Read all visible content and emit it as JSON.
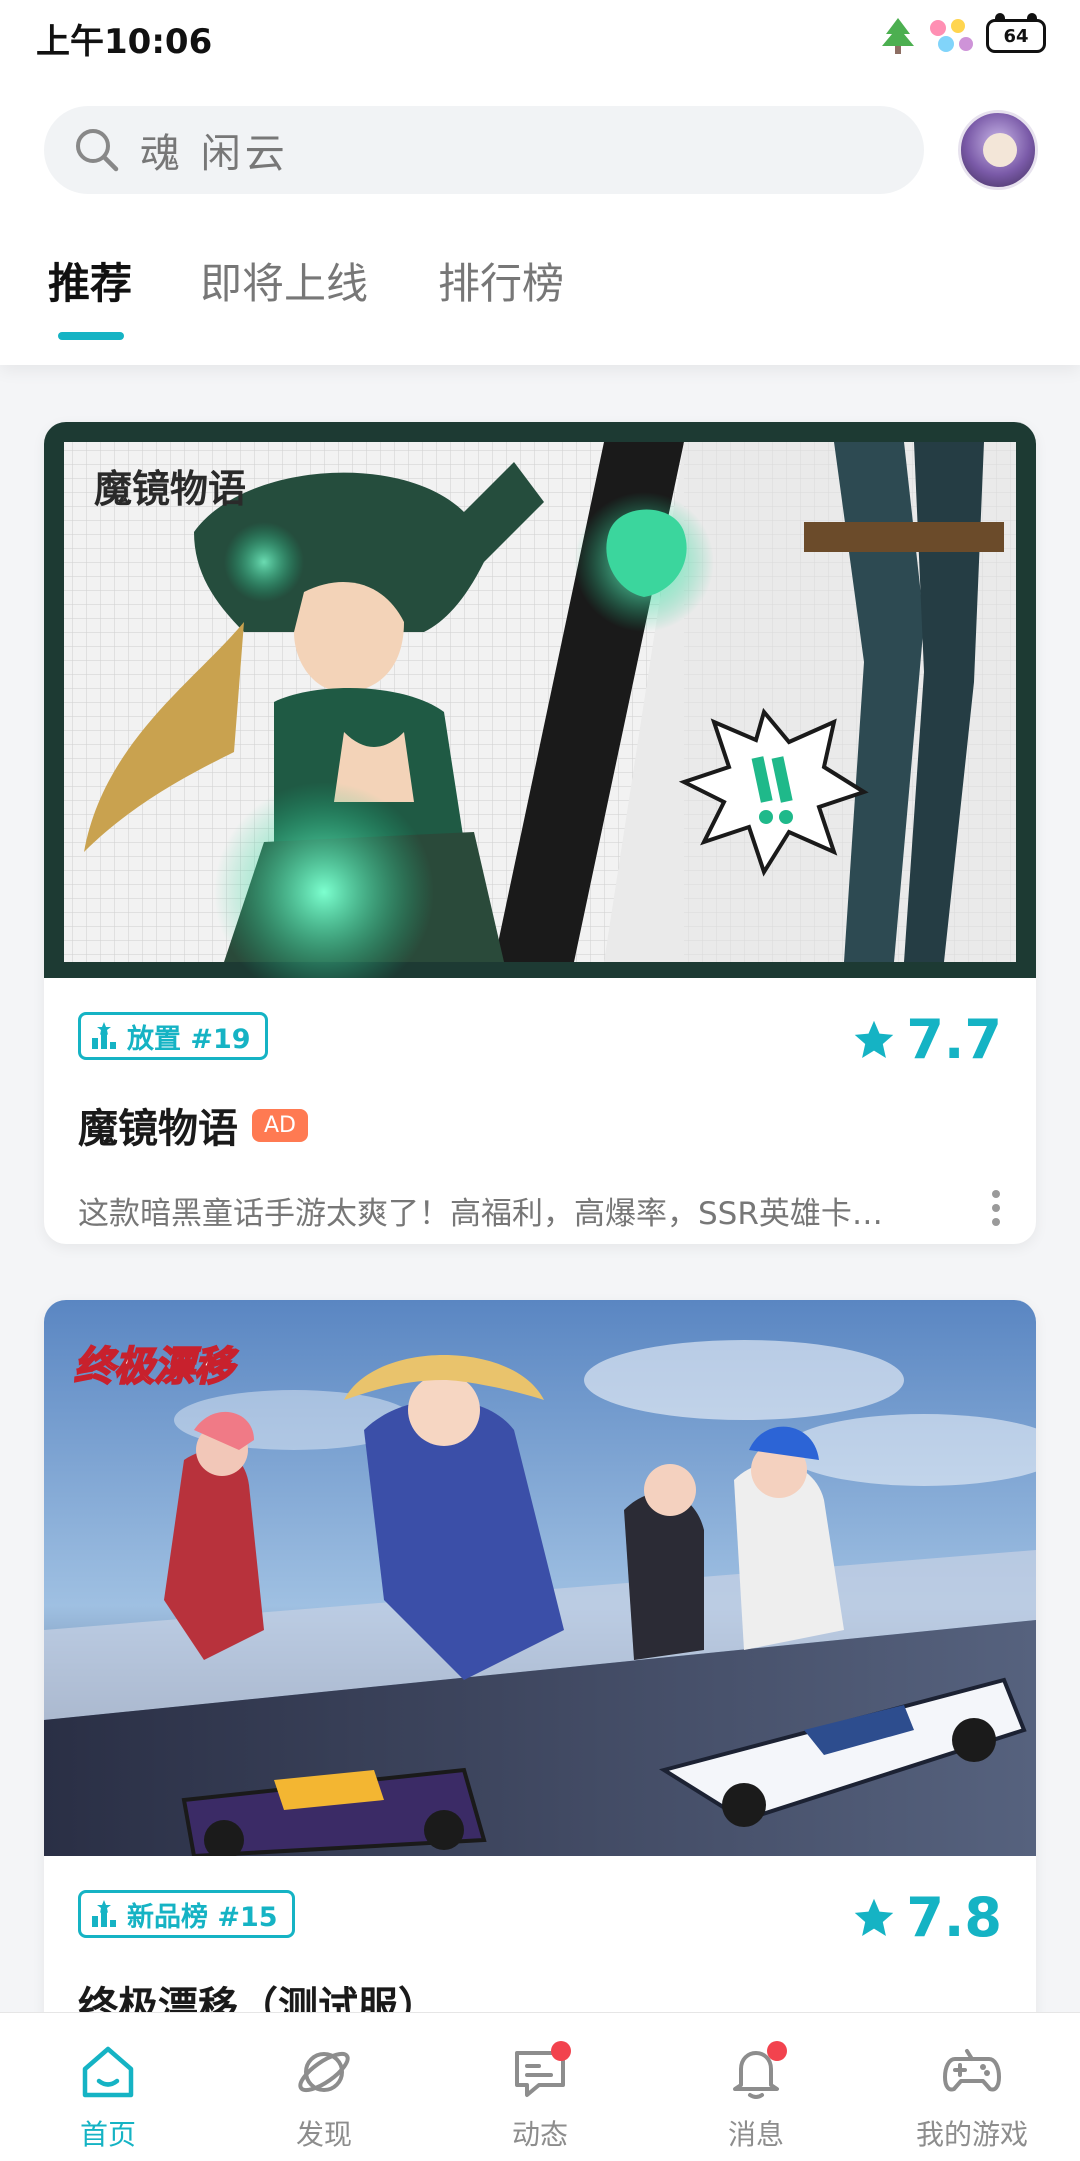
{
  "status_bar": {
    "time": "上午10:06",
    "battery": "64"
  },
  "search": {
    "query": "魂 闲云"
  },
  "tabs": [
    {
      "label": "推荐",
      "active": true
    },
    {
      "label": "即将上线",
      "active": false
    },
    {
      "label": "排行榜",
      "active": false
    }
  ],
  "cards": [
    {
      "rank_tag": "放置 #19",
      "rating": "7.7",
      "title": "魔镜物语",
      "badge": "AD",
      "description": "这款暗黑童话手游太爽了！高福利，高爆率，SSR英雄卡…",
      "image_label": "魔镜物语"
    },
    {
      "rank_tag": "新品榜 #15",
      "rating": "7.8",
      "title": "终极漂移（测试服）",
      "image_label": "终极漂移"
    }
  ],
  "bottom_nav": [
    {
      "label": "首页",
      "icon": "home-icon",
      "active": true
    },
    {
      "label": "发现",
      "icon": "planet-icon",
      "active": false
    },
    {
      "label": "动态",
      "icon": "chat-icon",
      "active": false,
      "dot": true
    },
    {
      "label": "消息",
      "icon": "bell-icon",
      "active": false,
      "dot": true
    },
    {
      "label": "我的游戏",
      "icon": "gamepad-icon",
      "active": false
    }
  ],
  "colors": {
    "accent": "#15b3c4",
    "ad": "#ff7a52",
    "dot": "#f2434e"
  }
}
